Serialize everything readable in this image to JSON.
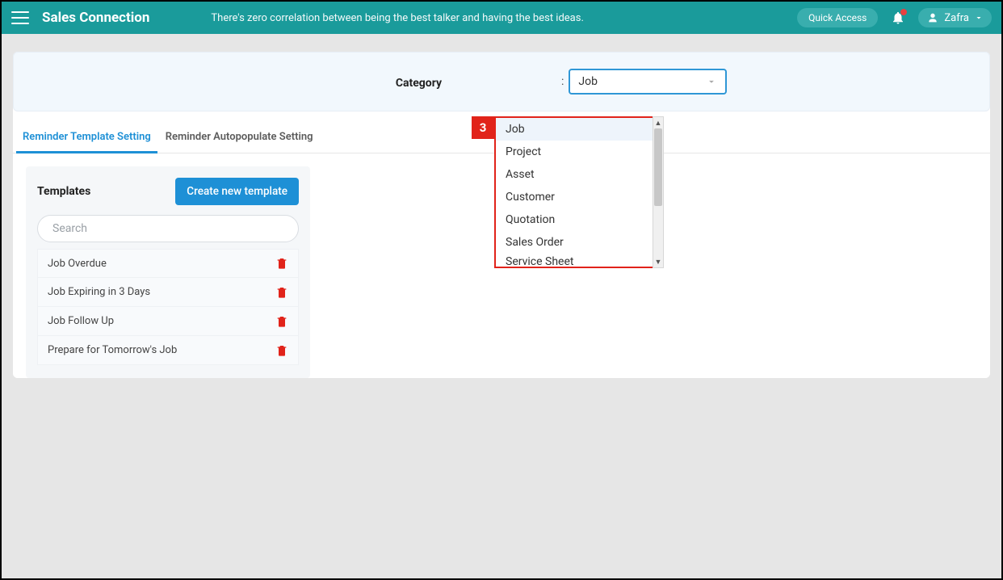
{
  "header": {
    "brand": "Sales Connection",
    "tagline": "There's zero correlation between being the best talker and having the best ideas.",
    "quick_access": "Quick Access",
    "user_name": "Zafra"
  },
  "category": {
    "label": "Category",
    "selected": "Job",
    "options": [
      "Job",
      "Project",
      "Asset",
      "Customer",
      "Quotation",
      "Sales Order",
      "Service Sheet"
    ]
  },
  "tabs": {
    "active": "Reminder Template Setting",
    "items": [
      "Reminder Template Setting",
      "Reminder Autopopulate Setting"
    ]
  },
  "templates": {
    "title": "Templates",
    "create_button": "Create new template",
    "search_placeholder": "Search",
    "items": [
      "Job Overdue",
      "Job Expiring in 3 Days",
      "Job Follow Up",
      "Prepare for Tomorrow's Job"
    ]
  },
  "annotation": {
    "step_number": "3"
  }
}
